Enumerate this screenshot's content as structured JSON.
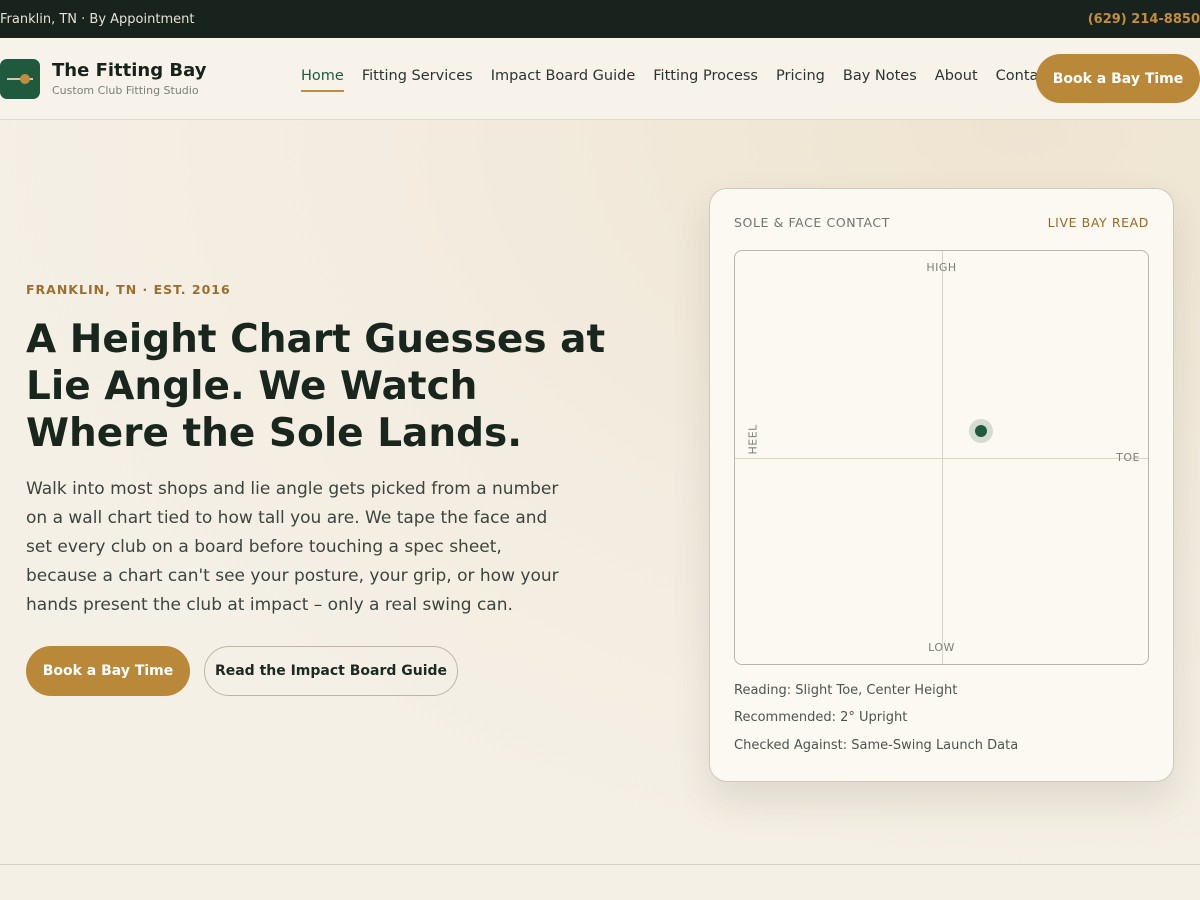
{
  "topbar": {
    "location": "Franklin, TN · By Appointment",
    "phone": "(629) 214-8850"
  },
  "brand": {
    "name": "The Fitting Bay",
    "tagline": "Custom Club Fitting Studio"
  },
  "nav": {
    "items": [
      {
        "label": "Home",
        "active": true
      },
      {
        "label": "Fitting Services"
      },
      {
        "label": "Impact Board Guide"
      },
      {
        "label": "Fitting Process"
      },
      {
        "label": "Pricing"
      },
      {
        "label": "Bay Notes"
      },
      {
        "label": "About"
      },
      {
        "label": "Contact"
      }
    ],
    "cta": "Book a Bay Time"
  },
  "hero": {
    "eyebrow": "FRANKLIN, TN · EST. 2016",
    "headline": "A Height Chart Guesses at Lie Angle. We Watch Where the Sole Lands.",
    "body": "Walk into most shops and lie angle gets picked from a number on a wall chart tied to how tall you are. We tape the face and set every club on a board before touching a spec sheet, because a chart can't see your posture, your grip, or how your hands present the club at impact – only a real swing can.",
    "primary_cta": "Book a Bay Time",
    "secondary_cta": "Read the Impact Board Guide"
  },
  "card": {
    "title": "SOLE & FACE CONTACT",
    "live_label": "LIVE BAY READ",
    "labels": {
      "high": "HIGH",
      "low": "LOW",
      "heel": "HEEL",
      "toe": "TOE"
    },
    "impact": {
      "toe_fraction": 0.595,
      "height_fraction": 0.435
    },
    "readings": [
      "Reading: Slight Toe, Center Height",
      "Recommended: 2° Upright",
      "Checked Against: Same-Swing Launch Data"
    ]
  },
  "colors": {
    "accent": "#b98838",
    "brand_green": "#1f5a3f",
    "topbar": "#17231c"
  }
}
